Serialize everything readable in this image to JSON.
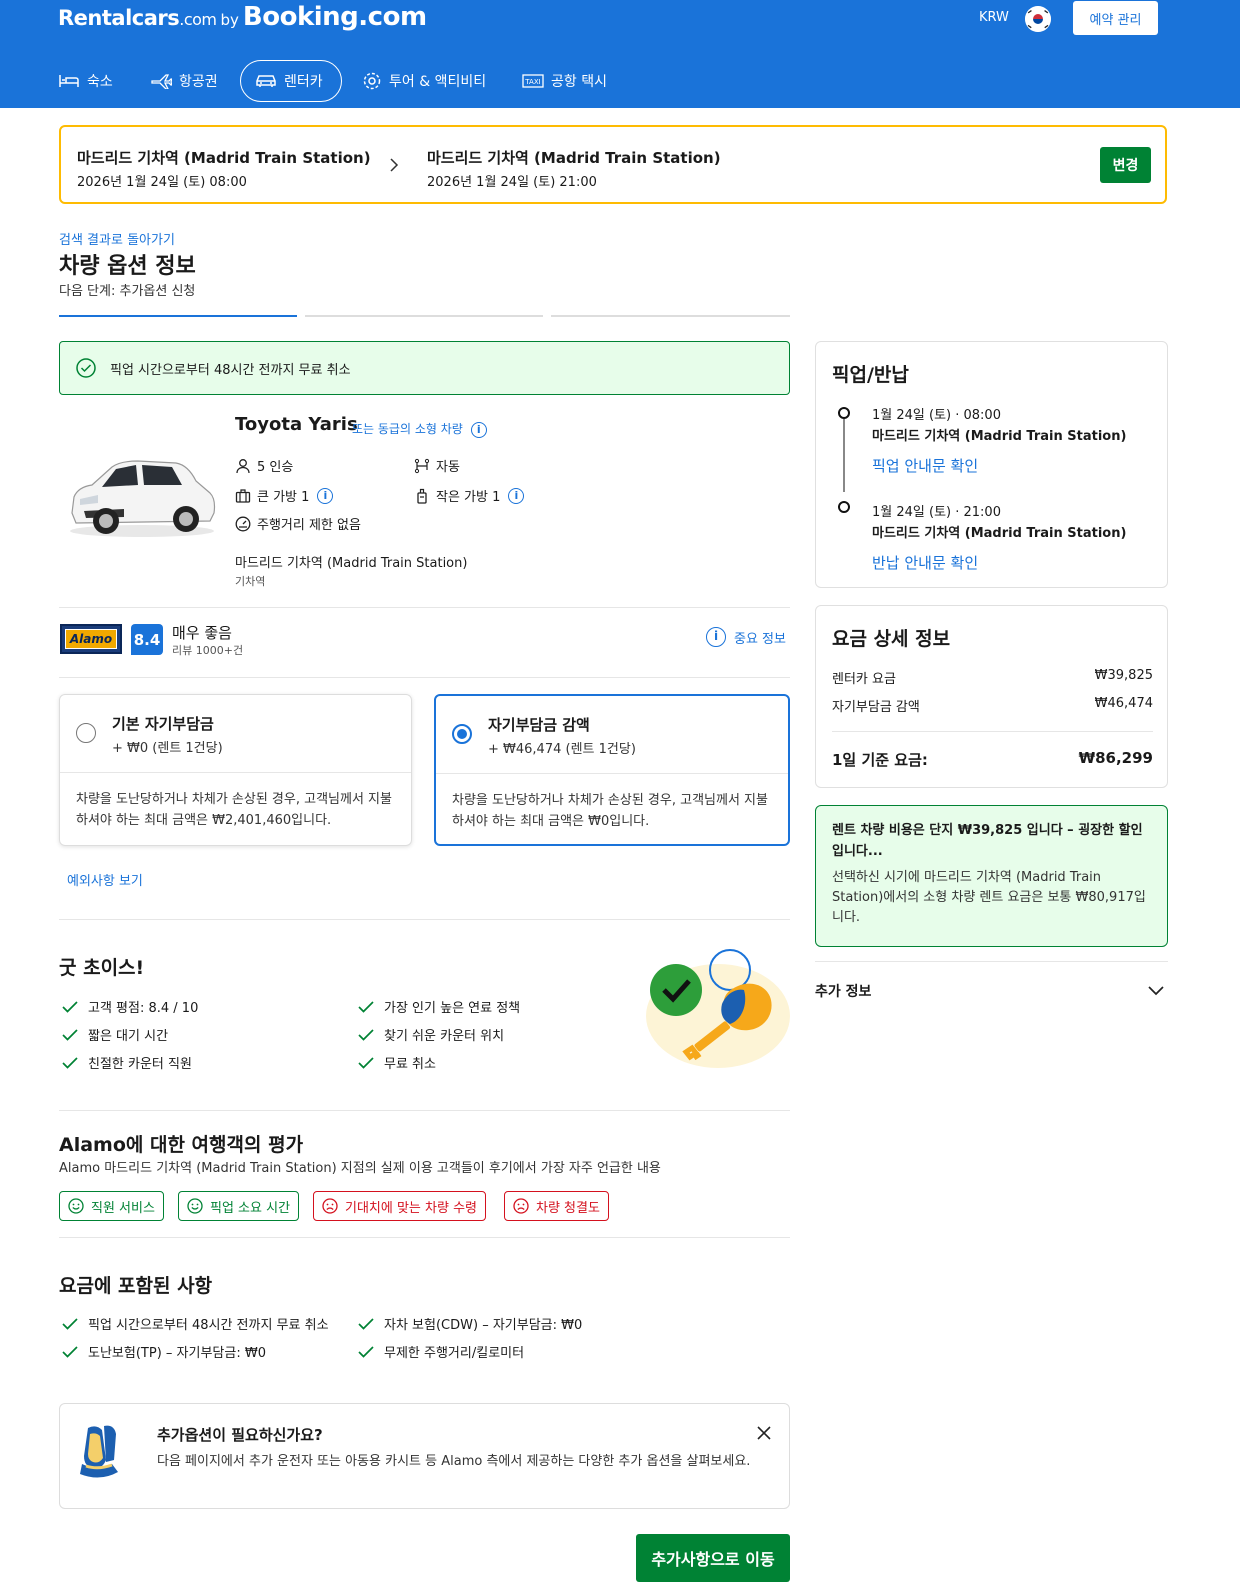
{
  "header": {
    "logo_rentalcars": "Rentalcars",
    "logo_com": ".com",
    "logo_by": "by",
    "logo_booking": "Booking.com",
    "currency": "KRW",
    "manage_booking": "예약 관리",
    "nav": [
      {
        "label": "숙소",
        "icon": "bed-icon"
      },
      {
        "label": "항공권",
        "icon": "plane-icon"
      },
      {
        "label": "렌터카",
        "icon": "car-icon",
        "active": true
      },
      {
        "label": "투어 & 액티비티",
        "icon": "attraction-icon"
      },
      {
        "label": "공항 택시",
        "icon": "taxi-icon"
      }
    ]
  },
  "search": {
    "pickup_location": "마드리드 기차역 (Madrid Train Station)",
    "pickup_date": "2026년 1월 24일 (토) 08:00",
    "dropoff_location": "마드리드 기차역 (Madrid Train Station)",
    "dropoff_date": "2026년 1월 24일 (토) 21:00",
    "change_label": "변경"
  },
  "page": {
    "back_link": "검색 결과로 돌아가기",
    "title": "차량 옵션 정보",
    "next_step": "다음 단계: 추가옵션 신청"
  },
  "cancel_banner": "픽업 시간으로부터 48시간 전까지 무료 취소",
  "car": {
    "name": "Toyota Yaris",
    "similar": "또는 동급의 소형 차량",
    "seats": "5 인승",
    "transmission": "자동",
    "large_bags": "큰 가방 1",
    "small_bags": "작은 가방 1",
    "mileage": "주행거리 제한 없음",
    "location": "마드리드 기차역 (Madrid Train Station)",
    "location_type": "기차역"
  },
  "supplier": {
    "name": "Alamo",
    "score": "8.4",
    "score_label": "매우 좋음",
    "reviews": "리뷰 1000+건",
    "important_info": "중요 정보"
  },
  "options": [
    {
      "title": "기본 자기부담금",
      "price": "+ ₩0 (렌트 1건당)",
      "desc": "차량을 도난당하거나 차체가 손상된 경우, 고객님께서 지불하셔야 하는 최대 금액은 ₩2,401,460입니다.",
      "selected": false
    },
    {
      "title": "자기부담금 감액",
      "price": "+ ₩46,474 (렌트 1건당)",
      "desc": "차량을 도난당하거나 차체가 손상된 경우, 고객님께서 지불하셔야 하는 최대 금액은 ₩0입니다.",
      "selected": true
    }
  ],
  "exceptions_link": "예외사항 보기",
  "good_choice": {
    "title": "굿 초이스!",
    "items": [
      "고객 평점: 8.4 / 10",
      "가장 인기 높은 연료 정책",
      "짧은 대기 시간",
      "찾기 쉬운 카운터 위치",
      "친절한 카운터 직원",
      "무료 취소"
    ]
  },
  "reviews": {
    "title": "Alamo에 대한 여행객의 평가",
    "subtitle": "Alamo 마드리드 기차역 (Madrid Train Station) 지점의 실제 이용 고객들이 후기에서 가장 자주 언급한 내용",
    "tags": [
      {
        "label": "직원 서비스",
        "sentiment": "positive"
      },
      {
        "label": "픽업 소요 시간",
        "sentiment": "positive"
      },
      {
        "label": "기대치에 맞는 차량 수령",
        "sentiment": "negative"
      },
      {
        "label": "차량 청결도",
        "sentiment": "negative"
      }
    ]
  },
  "included": {
    "title": "요금에 포함된 사항",
    "items": [
      "픽업 시간으로부터 48시간 전까지 무료 취소",
      "자차 보험(CDW) – 자기부담금: ₩0",
      "도난보험(TP) – 자기부담금: ₩0",
      "무제한 주행거리/킬로미터"
    ]
  },
  "extras": {
    "title": "추가옵션이 필요하신가요?",
    "desc": "다음 페이지에서 추가 운전자 또는 아동용 카시트 등 Alamo 측에서 제공하는 다양한 추가 옵션을 살펴보세요."
  },
  "next_button": "추가사항으로 이동",
  "sidebar": {
    "pickup_title": "픽업/반납",
    "pickup_datetime": "1월 24일 (토) · 08:00",
    "pickup_location": "마드리드 기차역 (Madrid Train Station)",
    "pickup_guide": "픽업 안내문 확인",
    "return_datetime": "1월 24일 (토) · 21:00",
    "return_location": "마드리드 기차역 (Madrid Train Station)",
    "return_guide": "반납 안내문 확인",
    "price_title": "요금 상세 정보",
    "rental_label": "렌터카 요금",
    "rental_value": "₩39,825",
    "excess_label": "자기부담금 감액",
    "excess_value": "₩46,474",
    "total_label": "1일 기준 요금:",
    "total_value": "₩86,299",
    "deal_title": "렌트 차량 비용은 단지 ₩39,825 입니다 – 굉장한 할인입니다...",
    "deal_desc": "선택하신 시기에 마드리드 기차역 (Madrid Train Station)에서의 소형 차량 렌트 요금은 보통 ₩80,917입니다.",
    "more_info": "추가 정보"
  },
  "colors": {
    "brand_blue": "#1a73d9",
    "green": "#008234",
    "yellow": "#febb02",
    "red": "#d4111e"
  }
}
